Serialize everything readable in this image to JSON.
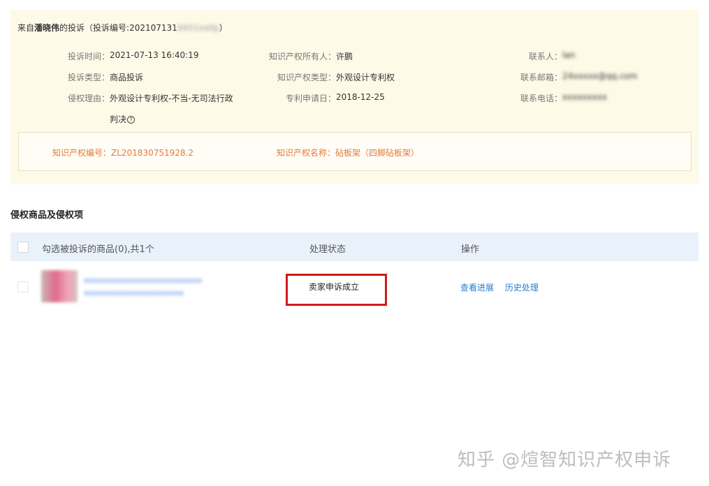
{
  "complaint": {
    "source_prefix": "来自",
    "complainant": "潘晓伟",
    "source_suffix": "的投诉（投诉编号:202107131",
    "id_hidden": "0451xx0p",
    "source_close": "）",
    "time_label": "投诉时间：",
    "time_value": "2021-07-13 16:40:19",
    "type_label": "投诉类型：",
    "type_value": "商品投诉",
    "reason_label": "侵权理由：",
    "reason_value_line1": "外观设计专利权-不当-无司法行政",
    "reason_value_line2": "判决",
    "owner_label": "知识产权所有人：",
    "owner_value": "许鹏",
    "ip_type_label": "知识产权类型：",
    "ip_type_value": "外观设计专利权",
    "patent_date_label": "专利申请日：",
    "patent_date_value": "2018-12-25",
    "contact_label": "联系人：",
    "contact_value": "lan",
    "email_label": "联系邮箱：",
    "email_value": "24xxxxx@qq.com",
    "phone_label": "联系电话：",
    "phone_value": "xxxxxxxxx"
  },
  "ip_info": {
    "number_label": "知识产权编号：",
    "number_value": "ZL201830751928.2",
    "name_label": "知识产权名称：",
    "name_value": "砧板架（四脚砧板架）"
  },
  "section_title": "侵权商品及侵权项",
  "table": {
    "col_select": "勾选被投诉的商品(0),共1个",
    "col_status": "处理状态",
    "col_action": "操作",
    "rows": [
      {
        "product_title_line1": "xxxxxxxxxxxxxxxxxxxxxxxxxx",
        "product_title_line2": "xxxxxxxxxxxxxxxxxxxxxx",
        "status": "卖家申诉成立",
        "action_progress": "查看进展",
        "action_history": "历史处理"
      }
    ]
  },
  "watermark": "知乎 @煊智知识产权申诉",
  "colors": {
    "panel_bg": "#fefae8",
    "ip_text": "#e37b3b",
    "link": "#2a7ccf",
    "highlight": "#d11b1b",
    "table_head_bg": "#e9f1fb"
  }
}
